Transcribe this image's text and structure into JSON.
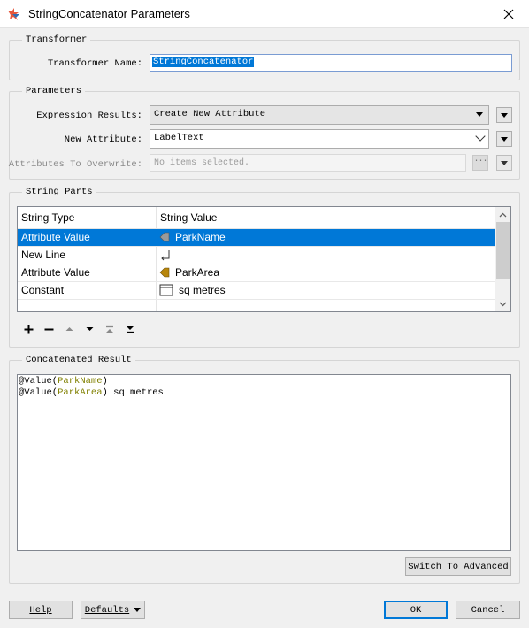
{
  "window": {
    "title": "StringConcatenator Parameters",
    "close_glyph": "✕"
  },
  "transformer": {
    "group_title": "Transformer",
    "name_label": "Transformer Name:",
    "name_value": "StringConcatenator"
  },
  "parameters": {
    "group_title": "Parameters",
    "expression_results_label": "Expression Results:",
    "expression_results_value": "Create New Attribute",
    "new_attribute_label": "New Attribute:",
    "new_attribute_value": "LabelText",
    "attributes_to_overwrite_label": "Attributes To Overwrite:",
    "attributes_to_overwrite_placeholder": "No items selected.",
    "dots_label": "···"
  },
  "string_parts": {
    "group_title": "String Parts",
    "columns": [
      "String Type",
      "String Value"
    ],
    "rows": [
      {
        "type": "Attribute Value",
        "value": "ParkName",
        "icon": "attribute-icon",
        "selected": true
      },
      {
        "type": "New Line",
        "value": "",
        "icon": "newline-icon",
        "selected": false
      },
      {
        "type": "Attribute Value",
        "value": "ParkArea",
        "icon": "attribute-icon",
        "selected": false
      },
      {
        "type": "Constant",
        "value": "sq metres",
        "icon": "constant-icon",
        "selected": false
      }
    ],
    "toolbar": [
      "add-icon",
      "remove-icon",
      "move-up-icon",
      "move-down-icon",
      "move-top-icon",
      "move-bottom-icon"
    ]
  },
  "concatenated_result": {
    "group_title": "Concatenated Result",
    "line1": {
      "fn": "@Value(",
      "attr": "ParkName",
      "end": ")"
    },
    "line2": {
      "fn": "@Value(",
      "attr": "ParkArea",
      "end": ")",
      "rest": " sq metres"
    },
    "switch_button": "Switch To Advanced"
  },
  "footer": {
    "help": "Help",
    "defaults": "Defaults",
    "ok": "OK",
    "cancel": "Cancel"
  },
  "colors": {
    "selection": "#0078d7",
    "attribute_text": "#808000",
    "attribute_icon": "#b8860b"
  }
}
